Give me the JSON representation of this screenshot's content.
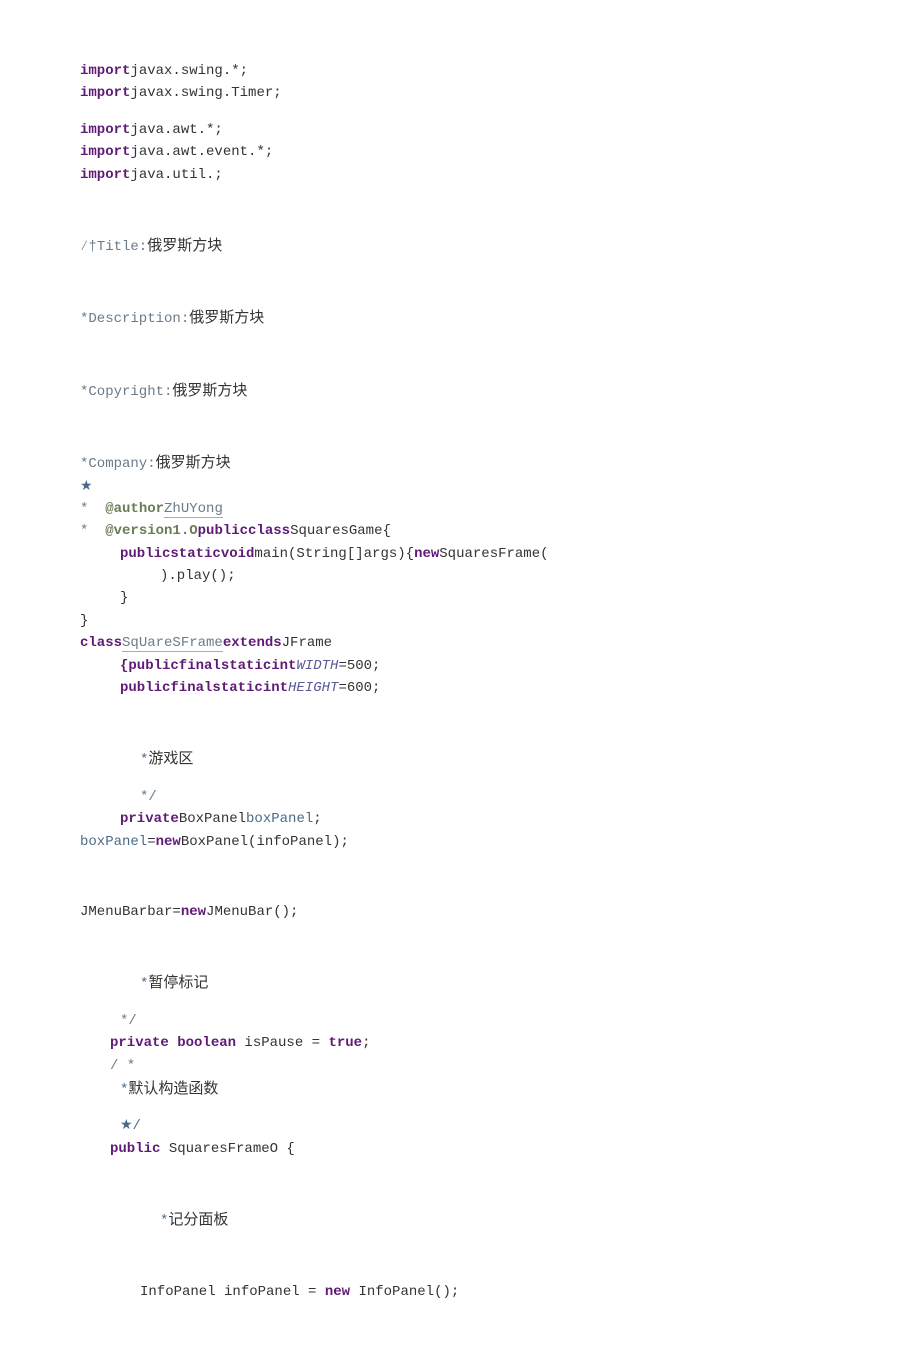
{
  "lines": {
    "import1_kw": "import",
    "import1_rest": "javax.swing.*;",
    "import2_kw": "import",
    "import2_rest": "javax.swing.Timer;",
    "import3_kw": "import",
    "import3_rest": "java.awt.*;",
    "import4_kw": "import",
    "import4_rest": "java.awt.event.*;",
    "import5_kw": "import",
    "import5_rest": "java.util.;",
    "title_prefix": "∕†Title:",
    "title_cn": "俄罗斯方块",
    "desc_prefix": "*Description:",
    "desc_cn": "俄罗斯方块",
    "copy_prefix": "*Copyright:",
    "copy_cn": "俄罗斯方块",
    "comp_prefix": "*Company:",
    "comp_cn": "俄罗斯方块",
    "star1": "★",
    "author_bullet": "*  ",
    "author_tag": "@author",
    "author_name": "ZhUYong",
    "ver_bullet": "*  ",
    "ver_tag": "@version1.O",
    "ver_kw": "publicclass",
    "ver_rest": "SquaresGame{",
    "main_kw": "publicstaticvoid",
    "main_sig": "main(String[]args){",
    "main_new": "new",
    "main_call": "SquaresFrame(",
    "main_play": ").play();",
    "main_close1": "}",
    "main_close2": "}",
    "class_kw1": "class",
    "class_name": "SqUareSFrame",
    "class_kw2": "extends",
    "class_ext": "JFrame",
    "width_kw": "{publicfinalstaticint",
    "width_id": "WIDTH",
    "width_val": "=500;",
    "height_kw": "publicfinalstaticint",
    "height_id": "HEIGHT",
    "height_val": "=600;",
    "game_area": "*游戏区",
    "star_slash": "*/",
    "priv_kw": "private",
    "priv_type": "BoxPanel",
    "priv_var": "boxPanel",
    "priv_end": ";",
    "boxpanel_var": "boxPanel",
    "boxpanel_eq": "=",
    "boxpanel_new": "new",
    "boxpanel_rest": "BoxPanel(infoPanel);",
    "menubar_pre": "JMenuBarbar=",
    "menubar_new": "new",
    "menubar_rest": "JMenuBar();",
    "pause_label": "*暂停标记",
    "pause_starslash": "*/",
    "pause_kw": "private boolean ",
    "pause_var": "isPause ",
    "pause_eq": "= ",
    "pause_true": "true",
    "pause_end": ";",
    "slash_star": "/ *",
    "ctor_label": "*默认构造函数",
    "star_slash2": "★/",
    "ctor_kw": "public ",
    "ctor_sig": "SquaresFrameO {",
    "score_label": "*记分面板",
    "infopanel_pre": "InfoPanel infoPanel = ",
    "infopanel_new": "new ",
    "infopanel_rest": "InfoPanel();"
  }
}
